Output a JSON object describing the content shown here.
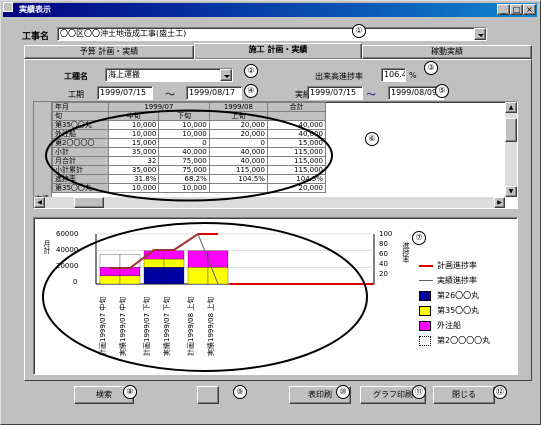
{
  "window": {
    "title": "実績表示"
  },
  "project": {
    "label": "工事名",
    "value": "〇〇区〇〇沖土地造成工事(盛土工)"
  },
  "tabs": [
    {
      "label": "予算 計画・実績"
    },
    {
      "label": "施工 計画・実績"
    },
    {
      "label": "稼動実績"
    }
  ],
  "work_type": {
    "label": "工種名",
    "value": "海上運搬"
  },
  "progress_rate": {
    "label": "出来高進捗率",
    "value": "106.4",
    "unit": "%"
  },
  "period": {
    "label": "工期",
    "from": "1999/07/15",
    "to": "1999/08/17",
    "sep": "〜",
    "actual_label": "実績",
    "actual_from": "1999/07/15",
    "actual_to": "1999/08/09"
  },
  "grid": {
    "head": {
      "col0": "年月",
      "month1": "1999/07",
      "month2": "1999/08",
      "total": "合計",
      "col0b": "旬",
      "c1": "中旬",
      "c2": "下旬",
      "c3": "上旬"
    },
    "rows": [
      {
        "name": "第35〇〇丸",
        "v": [
          "10,000",
          "10,000",
          "20,000",
          "40,000"
        ]
      },
      {
        "name": "外注船",
        "v": [
          "10,000",
          "10,000",
          "20,000",
          "40,000"
        ]
      },
      {
        "name": "第2〇〇〇〇",
        "v": [
          "15,000",
          "0",
          "0",
          "15,000"
        ]
      },
      {
        "name": "小計",
        "v": [
          "35,000",
          "40,000",
          "40,000",
          "115,000"
        ]
      },
      {
        "name": "月合計",
        "v": [
          "32",
          "75,000",
          "40,000",
          "115,000"
        ]
      },
      {
        "name": "小計累計",
        "v": [
          "35,000",
          "75,000",
          "115,000",
          "115,000"
        ]
      },
      {
        "name": "進捗率",
        "v": [
          "31.8%",
          "68.2%",
          "104.5%",
          "104.5%"
        ]
      },
      {
        "name": "第35〇〇丸",
        "v": [
          "10,000",
          "10,000",
          "",
          "20,000"
        ]
      }
    ],
    "side_label": "実績"
  },
  "chart_data": {
    "type": "bar",
    "y_left_label": "月計",
    "y_right_label": "進捗率",
    "ylim_left": [
      0,
      60000
    ],
    "yticks_left": [
      "60000",
      "40000",
      "20000",
      "0"
    ],
    "ylim_right": [
      0,
      100
    ],
    "yticks_right": [
      "100",
      "80",
      "60",
      "40",
      "20"
    ],
    "categories": [
      "計画1999/07 中旬",
      "実績1999/07 中旬",
      "計画1999/07 下旬",
      "実績1999/07 下旬",
      "計画1999/08 上旬",
      "実績1999/08 上旬"
    ],
    "series": [
      {
        "name": "第26〇〇丸",
        "color": "#0000a0",
        "values": [
          0,
          0,
          20000,
          20000,
          0,
          0
        ]
      },
      {
        "name": "第35〇〇丸",
        "color": "#ffff00",
        "values": [
          10000,
          10000,
          10000,
          10000,
          20000,
          20000
        ]
      },
      {
        "name": "外注船",
        "color": "#ff00ff",
        "values": [
          10000,
          10000,
          10000,
          10000,
          20000,
          20000
        ]
      },
      {
        "name": "第2〇〇〇〇丸",
        "color": "#ffffff",
        "values": [
          15000,
          15000,
          0,
          0,
          0,
          0
        ]
      }
    ],
    "lines": [
      {
        "name": "計画進捗率",
        "color": "#e00000",
        "values": [
          32,
          32,
          68,
          68,
          104,
          104
        ]
      },
      {
        "name": "実績進捗率",
        "color": "#606060",
        "values": [
          32,
          32,
          68,
          68,
          104,
          0
        ]
      }
    ]
  },
  "buttons": {
    "search": "検索",
    "print_table": "表印刷",
    "print_graph": "グラフ印刷",
    "close": "閉じる"
  },
  "markers": [
    "①",
    "②",
    "③",
    "④",
    "⑤",
    "⑥",
    "⑦",
    "⑧",
    "⑨",
    "⑩",
    "⑪",
    "⑫"
  ]
}
